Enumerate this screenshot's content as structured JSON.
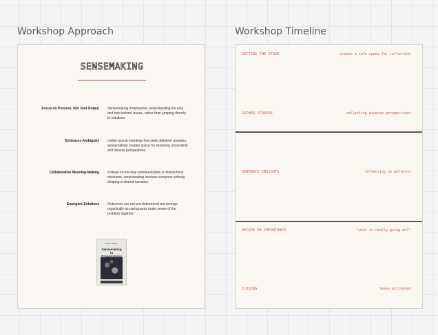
{
  "approach": {
    "title": "Workshop Approach",
    "logo_text": "Sensemaking",
    "principles": [
      {
        "label": "Focus on Process, Not Just Output",
        "description": "Sensemaking emphasizes understanding the why and how behind issues, rather than jumping directly to solutions."
      },
      {
        "label": "Embraces Ambiguity",
        "description": "Unlike typical meetings that seek definitive answers, sensemaking creates space for exploring uncertainty and diverse perspectives."
      },
      {
        "label": "Collaborative Meaning-Making",
        "description": "Instead of one-way communication or hierarchical decisions, sensemaking involves everyone actively shaping a shared narrative."
      },
      {
        "label": "Emergent Solutions",
        "description": "Outcomes are not pre-determined but emerge organically as participants make sense of the problem together."
      }
    ],
    "book": {
      "author": "Karl E. Weick",
      "title": "Sensemaking in Organizations"
    }
  },
  "timeline": {
    "title": "Workshop Timeline",
    "items": [
      {
        "step": "GETTING THE STAGE",
        "note": "create a safe space for reflection"
      },
      {
        "step": "GATHER STORIES",
        "note": "collecting diverse perspectives"
      },
      {
        "step": "GENERATE INSIGHTS",
        "note": "reflecting on patterns"
      },
      {
        "step": "DECIDE ON IMPORTANCE",
        "note": "\"what is really going on?\""
      },
      {
        "step": "CLOSING",
        "note": "leave activated"
      }
    ]
  }
}
